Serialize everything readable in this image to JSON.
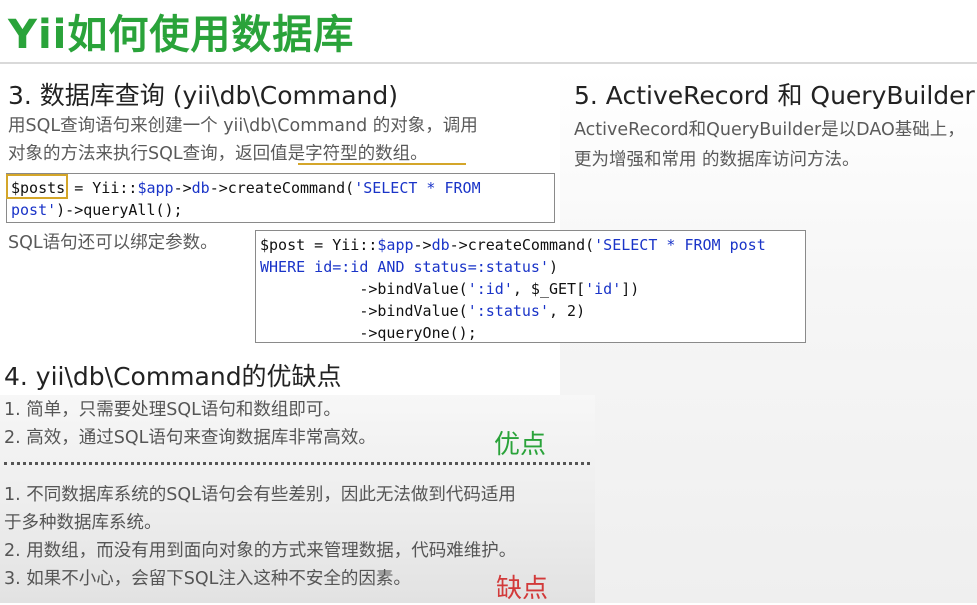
{
  "title": "Yii如何使用数据库",
  "section3": {
    "heading": "3. 数据库查询 (yii\\db\\Command)",
    "desc_line1": "用SQL查询语句来创建一个 yii\\db\\Command 的对象，调用",
    "desc_line2": "对象的方法来执行SQL查询，返回值是字符型的数组。",
    "code1": {
      "var": "$posts",
      "l1_mid": " = Yii::",
      "app": "$app",
      "arrow1": "->",
      "db": "db",
      "l1_call": "->createCommand(",
      "l1_sql": "'SELECT * FROM",
      "l2_sql": "post'",
      "l2_rest": ")->queryAll();"
    },
    "bind_note": "SQL语句还可以绑定参数。",
    "code2": {
      "l1_pre": "$post = Yii::",
      "app": "$app",
      "arrow1": "->",
      "db": "db",
      "l1_call": "->createCommand(",
      "l1_sql": "'SELECT * FROM post",
      "l2_sql": "WHERE id=:id AND status=:status'",
      "l2_rest": ")",
      "l3_pre": "           ->bindValue(",
      "l3_arg": "':id'",
      "l3_mid": ", $_GET[",
      "l3_key": "'id'",
      "l3_end": "])",
      "l4_pre": "           ->bindValue(",
      "l4_arg": "':status'",
      "l4_end": ", 2)",
      "l5": "           ->queryOne();"
    }
  },
  "section5": {
    "heading": "5. ActiveRecord 和 QueryBuilder",
    "desc_line1": "ActiveRecord和QueryBuilder是以DAO基础上，",
    "desc_line2": "更为增强和常用 的数据库访问方法。"
  },
  "section4": {
    "heading": "4. yii\\db\\Command的优缺点",
    "pros": [
      "1. 简单，只需要处理SQL语句和数组即可。",
      "2. 高效，通过SQL语句来查询数据库非常高效。"
    ],
    "pros_tag": "优点",
    "cons": [
      "1. 不同数据库系统的SQL语句会有些差别，因此无法做到代码适用",
      "于多种数据库系统。",
      "2. 用数组，而没有用到面向对象的方式来管理数据，代码难维护。",
      "3. 如果不小心，会留下SQL注入这种不安全的因素。"
    ],
    "cons_tag": "缺点"
  },
  "colors": {
    "title_green": "#2aa33a",
    "keyword_blue": "#1a34c8",
    "highlight_gold": "#d4a62a",
    "cons_red": "#d23a3a"
  }
}
